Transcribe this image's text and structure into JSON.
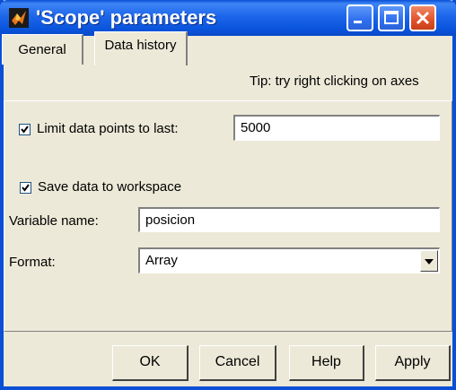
{
  "window": {
    "title": "'Scope' parameters"
  },
  "tabs": [
    {
      "label": "General",
      "selected": false
    },
    {
      "label": "Data history",
      "selected": true
    }
  ],
  "tip": "Tip: try right clicking on axes",
  "limit_points": {
    "checked": true,
    "label": "Limit data points to last:",
    "value": "5000"
  },
  "save_to_workspace": {
    "checked": true,
    "label": "Save data to workspace"
  },
  "variable_name": {
    "label": "Variable name:",
    "value": "posicion"
  },
  "format": {
    "label": "Format:",
    "value": "Array"
  },
  "buttons": {
    "ok": "OK",
    "cancel": "Cancel",
    "help": "Help",
    "apply": "Apply"
  },
  "colors": {
    "titlebar": "#0a4fd6",
    "face": "#ece9d8",
    "close_button": "#e0522a"
  }
}
